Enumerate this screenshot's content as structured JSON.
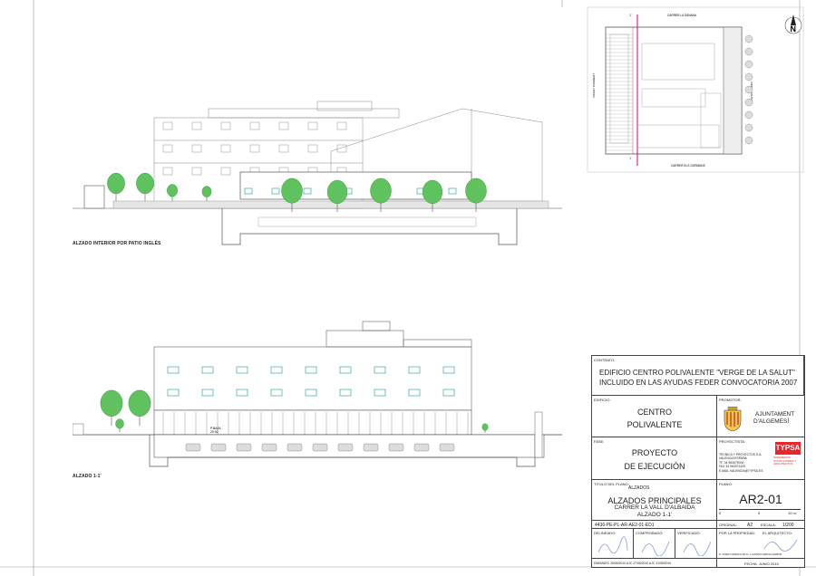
{
  "drawing": {
    "elevation_top_label": "ALZADO INTERIOR POR PATIO INGLÉS",
    "elevation_bottom_label": "ALZADO 1-1'",
    "level_note": "P.BAJA\n29.52",
    "plan": {
      "street_top": "CARRER LA SANANA",
      "street_bottom": "CARRER ELS GORMANS",
      "street_left": "VICENT PUIGBERT",
      "street_right": "VICENT FAUSTE",
      "section_mark_top": "1'",
      "section_mark_bottom": "1",
      "north": "N"
    }
  },
  "title_block": {
    "contrato_label": "CONTRATO:",
    "contrato_line1": "EDIFICIO CENTRO POLIVALENTE \"VERGE DE LA SALUT\"",
    "contrato_line2": "INCLUIDO EN LAS AYUDAS FEDER CONVOCATORIA 2007",
    "edificio_label": "EDIFICIO:",
    "edificio_line1": "CENTRO",
    "edificio_line2": "POLIVALENTE",
    "promotor_label": "PROMOTOR:",
    "promotor_line1": "AJUNTAMENT",
    "promotor_line2": "D'ALGEMESÍ",
    "fase_label": "FASE:",
    "fase_line1": "PROYECTO",
    "fase_line2": "DE EJECUCIÓN",
    "proyectista_label": "PROYECTISTA:",
    "proyectista_lines": [
      "TECNICA Y PROYECTOS S.A.",
      "VALENCIA          ESPAÑA",
      "TF.          34 963079000",
      "FAX         34 963071429",
      "E.MAIL VALENCIA@TYPSA.ES"
    ],
    "typsa_logo": "TYPSA",
    "typsa_sub": "INGENIEROS CONSULTORES Y ARQUITECTOS",
    "titulo_label": "TITULO DEL PLANO:",
    "titulo_top": "ALZADOS",
    "titulo_line1": "ALZADOS PRINCIPALES",
    "titulo_line2": "CARRER LA VALL D'ALBAIDA",
    "titulo_line3": "ALZADO 1-1'",
    "plano_label": "PLANO:",
    "plano_number": "AR2-01",
    "scale_ticks": [
      "0",
      "5",
      "10 m."
    ],
    "code": "4436-PE-PL-AR-AE2-01-ED1",
    "original_label": "ORIGINAL:",
    "original_value": "A2",
    "escala_label": "ESCALA:",
    "escala_value": "1/200",
    "delineado_label": "DELINEADO:",
    "comprobado_label": "COMPROBADO:",
    "verificado_label": "VERIFICADO:",
    "propiedad_label": "POR LA PROPIEDAD:",
    "arquitecto_label": "EL ARQUITECTO:",
    "sign_names": "D. VICENT GINER CLAR      D. J. ALONSO GARCIA CAMPOS",
    "date_row": "DIM/MARC   26/05/2010   AJC   27/05/2010   AJC   31/05/2010",
    "fecha": "FECHA: JUNIO 2010"
  },
  "colors": {
    "tree": "#5fc25f",
    "tree_dark": "#2f8f2f",
    "window": "#3aa6a6",
    "typsa_red": "#e8262d",
    "section_line": "#e0007a"
  }
}
